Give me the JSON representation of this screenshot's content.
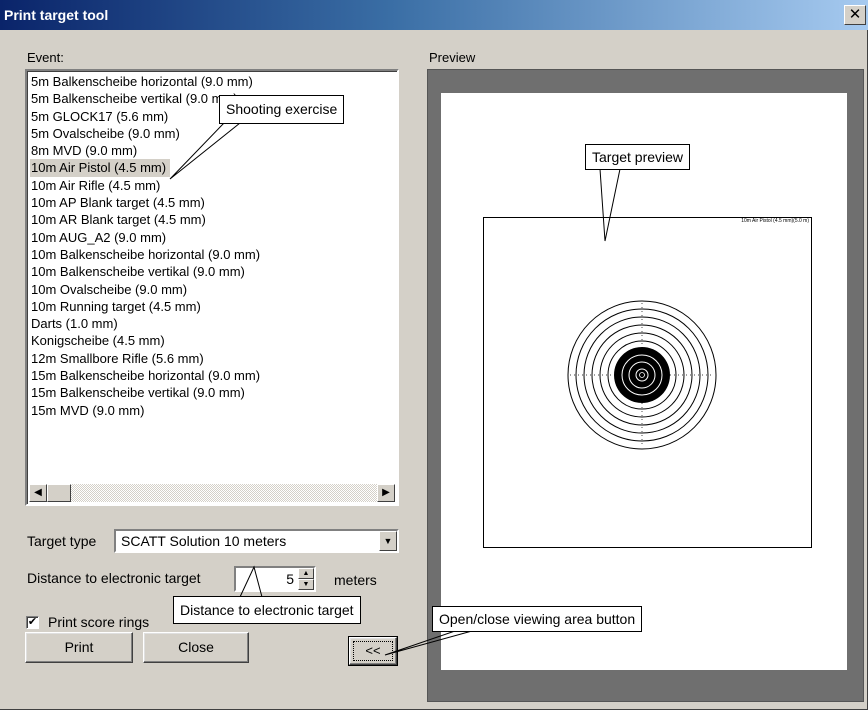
{
  "window": {
    "title": "Print target tool",
    "close_glyph": "✕"
  },
  "event": {
    "label": "Event:",
    "items": [
      "5m Balkenscheibe horizontal (9.0 mm)",
      "5m Balkenscheibe vertikal (9.0 mm)",
      "5m GLOCK17 (5.6 mm)",
      "5m Ovalscheibe (9.0 mm)",
      "8m MVD (9.0 mm)",
      "10m Air Pistol (4.5 mm)",
      "10m Air Rifle (4.5 mm)",
      "10m AP Blank target (4.5 mm)",
      "10m AR Blank target (4.5 mm)",
      "10m AUG_A2 (9.0 mm)",
      "10m Balkenscheibe horizontal (9.0 mm)",
      "10m Balkenscheibe vertikal (9.0 mm)",
      "10m Ovalscheibe (9.0 mm)",
      "10m Running target (4.5 mm)",
      "Darts (1.0 mm)",
      "Konigscheibe (4.5 mm)",
      "12m Smallbore Rifle (5.6 mm)",
      "15m Balkenscheibe horizontal (9.0 mm)",
      "15m Balkenscheibe vertikal (9.0 mm)",
      "15m MVD (9.0 mm)"
    ],
    "selected_index": 5
  },
  "scrollbar": {
    "left_glyph": "◀",
    "right_glyph": "▶"
  },
  "target_type": {
    "label": "Target type",
    "value": "SCATT Solution 10 meters",
    "arrow_glyph": "▼"
  },
  "distance": {
    "label": "Distance to electronic target",
    "value": "5",
    "unit": "meters",
    "up_glyph": "▲",
    "down_glyph": "▼"
  },
  "print_score_rings": {
    "label": "Print score rings",
    "checked": true,
    "check_glyph": "✔"
  },
  "buttons": {
    "print": "Print",
    "close": "Close",
    "toggle_preview": "<<"
  },
  "preview": {
    "label": "Preview",
    "target_header": "10m Air Pistol (4.5 mm)(5.0 m)"
  },
  "callouts": {
    "shooting_exercise": "Shooting exercise",
    "target_preview": "Target preview",
    "distance": "Distance to electronic target",
    "toggle_button": "Open/close viewing area button"
  }
}
